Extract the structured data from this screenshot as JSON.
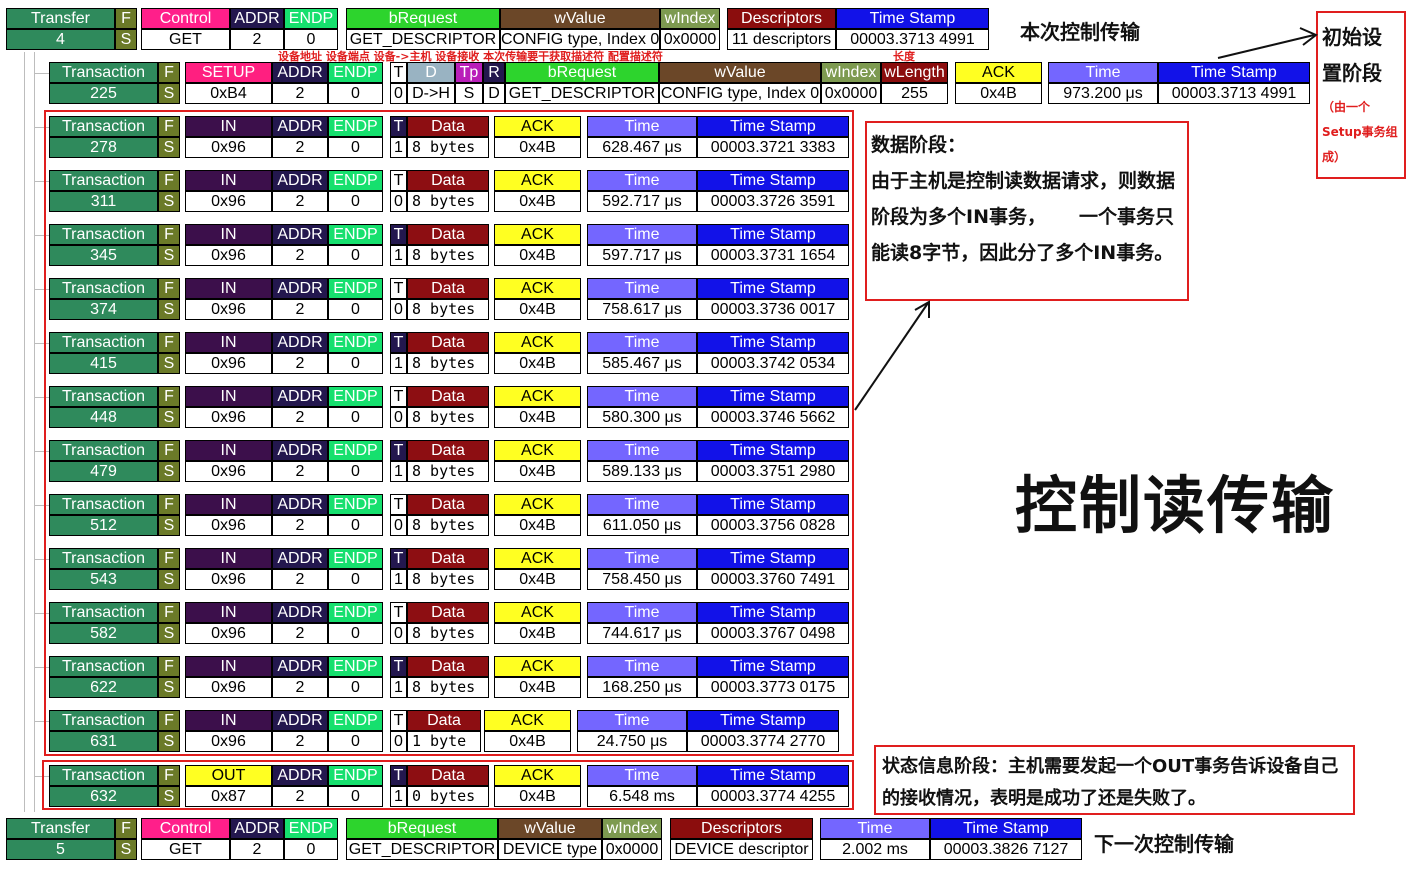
{
  "colors": {
    "green_dark": "#3a7d5f",
    "green_text_bg": "#2f8a5c",
    "pink": "#ff1f8a",
    "navy": "#23174e",
    "endp_green": "#16e06e",
    "brequest_green": "#2dd42d",
    "wvalue_brown": "#6b4728",
    "windex_olive": "#7d9a50",
    "descriptors_red": "#8b0d0d",
    "timestamp_blue": "#1212e8",
    "time_purple": "#7466ff",
    "setup_pink": "#ff1f80",
    "ack_yellow": "#ffff22",
    "data_red": "#8d0e12",
    "in_purple": "#3c0f4b",
    "out_yellow": "#ffff22",
    "annot_red": "#e01e1e"
  },
  "transfer4": {
    "h_transfer": "Transfer",
    "v_transfer": "4",
    "h_f": "F",
    "v_s": "S",
    "h_control": "Control",
    "v_control": "GET",
    "h_addr": "ADDR",
    "v_addr": "2",
    "h_endp": "ENDP",
    "v_endp": "0",
    "h_brequest": "bRequest",
    "v_brequest": "GET_DESCRIPTOR",
    "h_wvalue": "wValue",
    "v_wvalue": "CONFIG type, Index 0",
    "h_windex": "wIndex",
    "v_windex": "0x0000",
    "h_descriptors": "Descriptors",
    "v_descriptors": "11 descriptors",
    "h_timestamp": "Time Stamp",
    "v_timestamp": "00003.3713 4991"
  },
  "setup": {
    "h_transaction": "Transaction",
    "v_transaction": "225",
    "h_f": "F",
    "v_s": "S",
    "h_setup": "SETUP",
    "v_setup": "0xB4",
    "h_addr": "ADDR",
    "v_addr": "2",
    "h_endp": "ENDP",
    "v_endp": "0",
    "h_t": "T",
    "v_t": "0",
    "h_d": "D",
    "v_d": "D->H",
    "h_tp": "Tp",
    "v_tp": "S",
    "h_r": "R",
    "v_r": "D",
    "h_brequest": "bRequest",
    "v_brequest": "GET_DESCRIPTOR",
    "h_wvalue": "wValue",
    "v_wvalue": "CONFIG type, Index 0",
    "h_windex": "wIndex",
    "v_windex": "0x0000",
    "h_wlength": "wLength",
    "v_wlength": "255",
    "h_ack": "ACK",
    "v_ack": "0x4B",
    "h_time": "Time",
    "v_time": "973.200 μs",
    "h_timestamp": "Time Stamp",
    "v_timestamp": "00003.3713 4991"
  },
  "in_transactions": [
    {
      "h_transaction": "Transaction",
      "id": "278",
      "h_f": "F",
      "v_s": "S",
      "h_in": "IN",
      "pid": "0x96",
      "h_addr": "ADDR",
      "addr": "2",
      "h_endp": "ENDP",
      "endp": "0",
      "h_t": "T",
      "t": "1",
      "h_data": "Data",
      "data": "8 bytes",
      "h_ack": "ACK",
      "ack": "0x4B",
      "h_time": "Time",
      "time": "628.467 μs",
      "h_timestamp": "Time Stamp",
      "timestamp": "00003.3721 3383"
    },
    {
      "h_transaction": "Transaction",
      "id": "311",
      "h_f": "F",
      "v_s": "S",
      "h_in": "IN",
      "pid": "0x96",
      "h_addr": "ADDR",
      "addr": "2",
      "h_endp": "ENDP",
      "endp": "0",
      "h_t": "T",
      "t": "0",
      "h_data": "Data",
      "data": "8 bytes",
      "h_ack": "ACK",
      "ack": "0x4B",
      "h_time": "Time",
      "time": "592.717 μs",
      "h_timestamp": "Time Stamp",
      "timestamp": "00003.3726 3591"
    },
    {
      "h_transaction": "Transaction",
      "id": "345",
      "h_f": "F",
      "v_s": "S",
      "h_in": "IN",
      "pid": "0x96",
      "h_addr": "ADDR",
      "addr": "2",
      "h_endp": "ENDP",
      "endp": "0",
      "h_t": "T",
      "t": "1",
      "h_data": "Data",
      "data": "8 bytes",
      "h_ack": "ACK",
      "ack": "0x4B",
      "h_time": "Time",
      "time": "597.717 μs",
      "h_timestamp": "Time Stamp",
      "timestamp": "00003.3731 1654"
    },
    {
      "h_transaction": "Transaction",
      "id": "374",
      "h_f": "F",
      "v_s": "S",
      "h_in": "IN",
      "pid": "0x96",
      "h_addr": "ADDR",
      "addr": "2",
      "h_endp": "ENDP",
      "endp": "0",
      "h_t": "T",
      "t": "0",
      "h_data": "Data",
      "data": "8 bytes",
      "h_ack": "ACK",
      "ack": "0x4B",
      "h_time": "Time",
      "time": "758.617 μs",
      "h_timestamp": "Time Stamp",
      "timestamp": "00003.3736 0017"
    },
    {
      "h_transaction": "Transaction",
      "id": "415",
      "h_f": "F",
      "v_s": "S",
      "h_in": "IN",
      "pid": "0x96",
      "h_addr": "ADDR",
      "addr": "2",
      "h_endp": "ENDP",
      "endp": "0",
      "h_t": "T",
      "t": "1",
      "h_data": "Data",
      "data": "8 bytes",
      "h_ack": "ACK",
      "ack": "0x4B",
      "h_time": "Time",
      "time": "585.467 μs",
      "h_timestamp": "Time Stamp",
      "timestamp": "00003.3742 0534"
    },
    {
      "h_transaction": "Transaction",
      "id": "448",
      "h_f": "F",
      "v_s": "S",
      "h_in": "IN",
      "pid": "0x96",
      "h_addr": "ADDR",
      "addr": "2",
      "h_endp": "ENDP",
      "endp": "0",
      "h_t": "T",
      "t": "0",
      "h_data": "Data",
      "data": "8 bytes",
      "h_ack": "ACK",
      "ack": "0x4B",
      "h_time": "Time",
      "time": "580.300 μs",
      "h_timestamp": "Time Stamp",
      "timestamp": "00003.3746 5662"
    },
    {
      "h_transaction": "Transaction",
      "id": "479",
      "h_f": "F",
      "v_s": "S",
      "h_in": "IN",
      "pid": "0x96",
      "h_addr": "ADDR",
      "addr": "2",
      "h_endp": "ENDP",
      "endp": "0",
      "h_t": "T",
      "t": "1",
      "h_data": "Data",
      "data": "8 bytes",
      "h_ack": "ACK",
      "ack": "0x4B",
      "h_time": "Time",
      "time": "589.133 μs",
      "h_timestamp": "Time Stamp",
      "timestamp": "00003.3751 2980"
    },
    {
      "h_transaction": "Transaction",
      "id": "512",
      "h_f": "F",
      "v_s": "S",
      "h_in": "IN",
      "pid": "0x96",
      "h_addr": "ADDR",
      "addr": "2",
      "h_endp": "ENDP",
      "endp": "0",
      "h_t": "T",
      "t": "0",
      "h_data": "Data",
      "data": "8 bytes",
      "h_ack": "ACK",
      "ack": "0x4B",
      "h_time": "Time",
      "time": "611.050 μs",
      "h_timestamp": "Time Stamp",
      "timestamp": "00003.3756 0828"
    },
    {
      "h_transaction": "Transaction",
      "id": "543",
      "h_f": "F",
      "v_s": "S",
      "h_in": "IN",
      "pid": "0x96",
      "h_addr": "ADDR",
      "addr": "2",
      "h_endp": "ENDP",
      "endp": "0",
      "h_t": "T",
      "t": "1",
      "h_data": "Data",
      "data": "8 bytes",
      "h_ack": "ACK",
      "ack": "0x4B",
      "h_time": "Time",
      "time": "758.450 μs",
      "h_timestamp": "Time Stamp",
      "timestamp": "00003.3760 7491"
    },
    {
      "h_transaction": "Transaction",
      "id": "582",
      "h_f": "F",
      "v_s": "S",
      "h_in": "IN",
      "pid": "0x96",
      "h_addr": "ADDR",
      "addr": "2",
      "h_endp": "ENDP",
      "endp": "0",
      "h_t": "T",
      "t": "0",
      "h_data": "Data",
      "data": "8 bytes",
      "h_ack": "ACK",
      "ack": "0x4B",
      "h_time": "Time",
      "time": "744.617 μs",
      "h_timestamp": "Time Stamp",
      "timestamp": "00003.3767 0498"
    },
    {
      "h_transaction": "Transaction",
      "id": "622",
      "h_f": "F",
      "v_s": "S",
      "h_in": "IN",
      "pid": "0x96",
      "h_addr": "ADDR",
      "addr": "2",
      "h_endp": "ENDP",
      "endp": "0",
      "h_t": "T",
      "t": "1",
      "h_data": "Data",
      "data": "8 bytes",
      "h_ack": "ACK",
      "ack": "0x4B",
      "h_time": "Time",
      "time": "168.250 μs",
      "h_timestamp": "Time Stamp",
      "timestamp": "00003.3773 0175"
    },
    {
      "h_transaction": "Transaction",
      "id": "631",
      "h_f": "F",
      "v_s": "S",
      "h_in": "IN",
      "pid": "0x96",
      "h_addr": "ADDR",
      "addr": "2",
      "h_endp": "ENDP",
      "endp": "0",
      "h_t": "T",
      "t": "0",
      "h_data": "Data",
      "data": "1 byte",
      "h_ack": "ACK",
      "ack": "0x4B",
      "h_time": "Time",
      "time": "24.750 μs",
      "h_timestamp": "Time Stamp",
      "timestamp": "00003.3774 2770"
    }
  ],
  "status": {
    "h_transaction": "Transaction",
    "v_transaction": "632",
    "h_f": "F",
    "v_s": "S",
    "h_out": "OUT",
    "v_out": "0x87",
    "h_addr": "ADDR",
    "v_addr": "2",
    "h_endp": "ENDP",
    "v_endp": "0",
    "h_t": "T",
    "v_t": "1",
    "h_data": "Data",
    "v_data": "0 bytes",
    "h_ack": "ACK",
    "v_ack": "0x4B",
    "h_time": "Time",
    "v_time": "6.548 ms",
    "h_timestamp": "Time Stamp",
    "v_timestamp": "00003.3774 4255"
  },
  "transfer5": {
    "h_transfer": "Transfer",
    "v_transfer": "5",
    "h_f": "F",
    "v_s": "S",
    "h_control": "Control",
    "v_control": "GET",
    "h_addr": "ADDR",
    "v_addr": "2",
    "h_endp": "ENDP",
    "v_endp": "0",
    "h_brequest": "bRequest",
    "v_brequest": "GET_DESCRIPTOR",
    "h_wvalue": "wValue",
    "v_wvalue": "DEVICE type",
    "h_windex": "wIndex",
    "v_windex": "0x0000",
    "h_descriptors": "Descriptors",
    "v_descriptors": "DEVICE descriptor",
    "h_time": "Time",
    "v_time": "2.002 ms",
    "h_timestamp": "Time Stamp",
    "v_timestamp": "00003.3826 7127"
  },
  "annotations": {
    "this_transfer": "本次控制传输",
    "setup_stage_title": "初始设置阶段",
    "setup_stage_sub": "（由一个Setup事务组成）",
    "red_labels": "设备地址  设备端点     设备->主机  设备接收  本次传输要干获取描述符    配置描述符",
    "red_length": "长度",
    "data_stage_title": "数据阶段：",
    "data_stage_body": "由于主机是控制读数据请求，则数据阶段为多个IN事务，     一个事务只能读8字节，因此分了多个IN事务。",
    "big_title": "控制读传输",
    "status_stage": "状态信息阶段：主机需要发起一个OUT事务告诉设备自己的接收情况，表明是成功了还是失败了。",
    "next_transfer": "下一次控制传输"
  }
}
